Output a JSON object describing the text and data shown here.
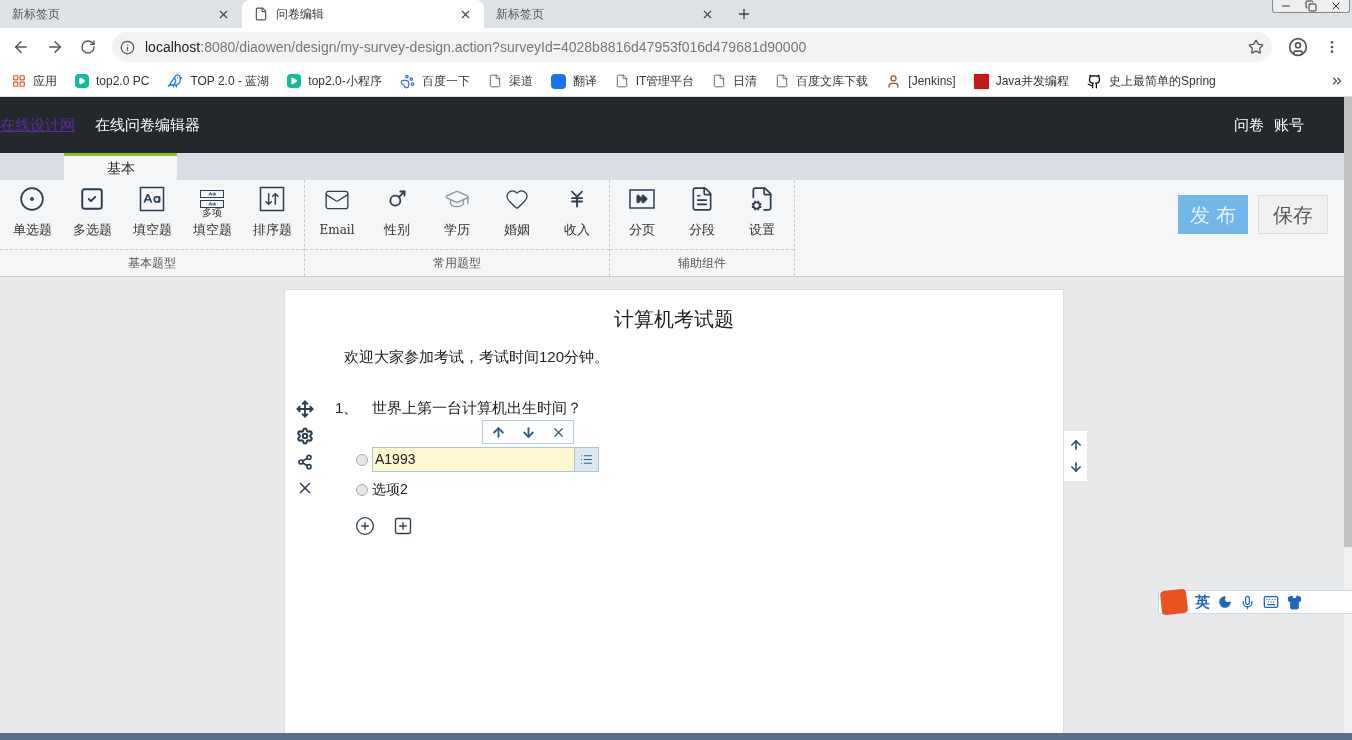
{
  "browser": {
    "tabs": [
      {
        "title": "新标签页",
        "selected": false
      },
      {
        "title": "问卷编辑",
        "selected": true
      },
      {
        "title": "新标签页",
        "selected": false
      }
    ],
    "url": {
      "host": "localhost",
      "rest": ":8080/diaowen/design/my-survey-design.action?surveyId=4028b8816d47953f016d479681d90000"
    },
    "bookmarks": [
      {
        "label": "应用",
        "kind": "apps"
      },
      {
        "label": "top2.0 PC",
        "kind": "play"
      },
      {
        "label": "TOP 2.0 - 蓝湖",
        "kind": "bird"
      },
      {
        "label": "top2.0-小程序",
        "kind": "play"
      },
      {
        "label": "百度一下",
        "kind": "paw"
      },
      {
        "label": "渠道",
        "kind": "file"
      },
      {
        "label": "翻译",
        "kind": "translate"
      },
      {
        "label": "IT管理平台",
        "kind": "file"
      },
      {
        "label": "日清",
        "kind": "file"
      },
      {
        "label": "百度文库下载",
        "kind": "file"
      },
      {
        "label": "[Jenkins]",
        "kind": "person"
      },
      {
        "label": "Java并发编程",
        "kind": "c"
      },
      {
        "label": "史上最简单的Spring",
        "kind": "github"
      }
    ]
  },
  "header": {
    "logo_link": "在线设计网",
    "title": "在线问卷编辑器",
    "nav": [
      "问卷",
      "账号"
    ]
  },
  "ribbon_tabs": [
    {
      "label": "基本",
      "selected": true
    }
  ],
  "toolbar_groups": [
    {
      "label": "基本题型",
      "items": [
        {
          "label": "单选题",
          "kind": "radio"
        },
        {
          "label": "多选题",
          "kind": "checkbox"
        },
        {
          "label": "填空题",
          "kind": "text"
        },
        {
          "label": "填空题",
          "kind": "multitext",
          "badge": "多项"
        },
        {
          "label": "排序题",
          "kind": "sort"
        }
      ]
    },
    {
      "label": "常用题型",
      "items": [
        {
          "label": "Email",
          "kind": "mail"
        },
        {
          "label": "性别",
          "kind": "gender"
        },
        {
          "label": "学历",
          "kind": "cap"
        },
        {
          "label": "婚姻",
          "kind": "heart"
        },
        {
          "label": "收入",
          "kind": "yen"
        }
      ]
    },
    {
      "label": "辅助组件",
      "items": [
        {
          "label": "分页",
          "kind": "page"
        },
        {
          "label": "分段",
          "kind": "doc"
        },
        {
          "label": "设置",
          "kind": "settings"
        }
      ]
    }
  ],
  "actions": [
    {
      "label": "发 布",
      "kind": "primary"
    },
    {
      "label": "保存",
      "kind": "secondary"
    }
  ],
  "survey": {
    "title": "计算机考试题",
    "intro": "欢迎大家参加考试，考试时间120分钟。",
    "questions": [
      {
        "number": "1、",
        "text": "世界上第一台计算机出生时间？",
        "options": [
          {
            "label": "A1993",
            "selected": false,
            "editing": true
          },
          {
            "label": "选项2",
            "selected": false,
            "editing": false
          }
        ]
      }
    ]
  },
  "ime": {
    "mode": "英"
  }
}
